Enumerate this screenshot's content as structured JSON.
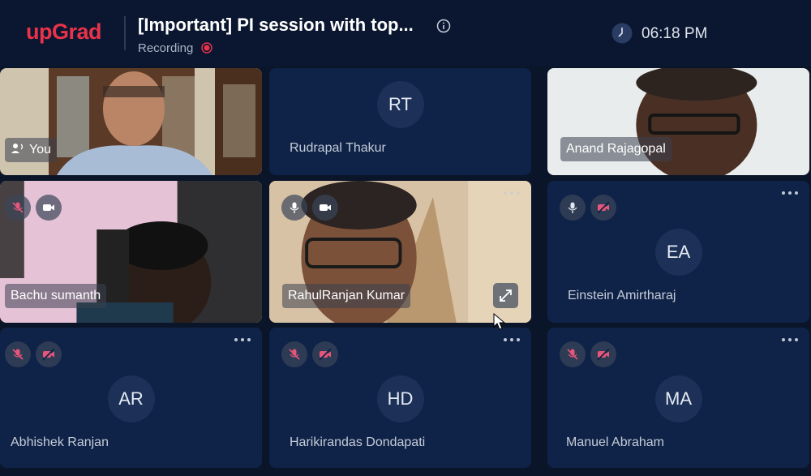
{
  "header": {
    "logo_text": "upGrad",
    "meeting_title": "[Important] PI session with top...",
    "recording_label": "Recording",
    "clock_time": "06:18 PM",
    "colors": {
      "brand": "#e8334a",
      "background": "#0b1730",
      "recording": "#e8334a"
    }
  },
  "participants": [
    {
      "name": "You",
      "initials": "",
      "video": true
    },
    {
      "name": "Rudrapal Thakur",
      "initials": "RT",
      "video": false
    },
    {
      "name": "Anand Rajagopal",
      "initials": "",
      "video": true
    },
    {
      "name": "Bachu sumanth",
      "initials": "",
      "video": true,
      "mic": "muted",
      "camera": "on"
    },
    {
      "name": "RahulRanjan Kumar",
      "initials": "",
      "video": true,
      "mic": "on",
      "camera": "on"
    },
    {
      "name": "Einstein Amirtharaj",
      "initials": "EA",
      "video": false,
      "mic": "on",
      "camera": "off"
    },
    {
      "name": "Abhishek Ranjan",
      "initials": "AR",
      "video": false,
      "mic": "muted",
      "camera": "off"
    },
    {
      "name": "Harikirandas Dondapati",
      "initials": "HD",
      "video": false,
      "mic": "muted",
      "camera": "off"
    },
    {
      "name": "Manuel Abraham",
      "initials": "MA",
      "video": false,
      "mic": "muted",
      "camera": "off"
    }
  ],
  "icons": {
    "info": "info-icon",
    "recording": "record-dot-icon",
    "clock": "clock-icon",
    "you": "speaker-person-icon",
    "mic": "microphone-icon",
    "mic_muted": "microphone-muted-icon",
    "camera": "camera-icon",
    "camera_off": "camera-off-icon",
    "more": "more-options-icon",
    "expand": "expand-icon",
    "cursor": "mouse-cursor-icon"
  }
}
